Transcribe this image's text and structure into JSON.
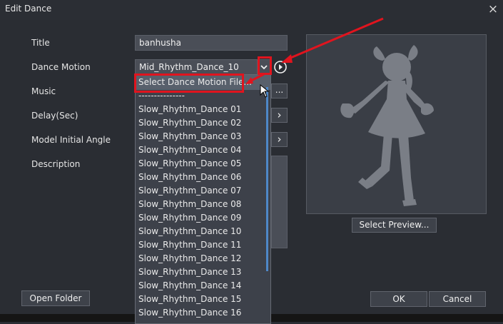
{
  "dialog": {
    "title": "Edit Dance",
    "close_glyph": "×"
  },
  "form": {
    "title_label": "Title",
    "title_value": "banhusha",
    "dance_motion_label": "Dance Motion",
    "dance_motion_value": "Mid_Rhythm_Dance_10",
    "music_label": "Music",
    "delay_label": "Delay(Sec)",
    "angle_label": "Model Initial Angle",
    "description_label": "Description"
  },
  "dropdown": {
    "items": [
      "Select Dance Motion File...",
      "---------------",
      "Slow_Rhythm_Dance 01",
      "Slow_Rhythm_Dance 02",
      "Slow_Rhythm_Dance 03",
      "Slow_Rhythm_Dance 04",
      "Slow_Rhythm_Dance 05",
      "Slow_Rhythm_Dance 06",
      "Slow_Rhythm_Dance 07",
      "Slow_Rhythm_Dance 08",
      "Slow_Rhythm_Dance 09",
      "Slow_Rhythm_Dance 10",
      "Slow_Rhythm_Dance 11",
      "Slow_Rhythm_Dance 12",
      "Slow_Rhythm_Dance 13",
      "Slow_Rhythm_Dance 14",
      "Slow_Rhythm_Dance 15",
      "Slow_Rhythm_Dance 16"
    ]
  },
  "buttons": {
    "browse": "...",
    "next": "›",
    "select_preview": "Select Preview...",
    "open_folder": "Open Folder",
    "ok": "OK",
    "cancel": "Cancel"
  },
  "icons": {
    "chevron": "chevron-down-icon",
    "play": "play-circle-icon",
    "silhouette": "dancer-silhouette-icon",
    "cursor": "mouse-cursor-icon",
    "arrow": "annotation-arrow-icon"
  },
  "colors": {
    "annotation_red": "#e0141e",
    "scroll_accent": "#4e88c8"
  }
}
